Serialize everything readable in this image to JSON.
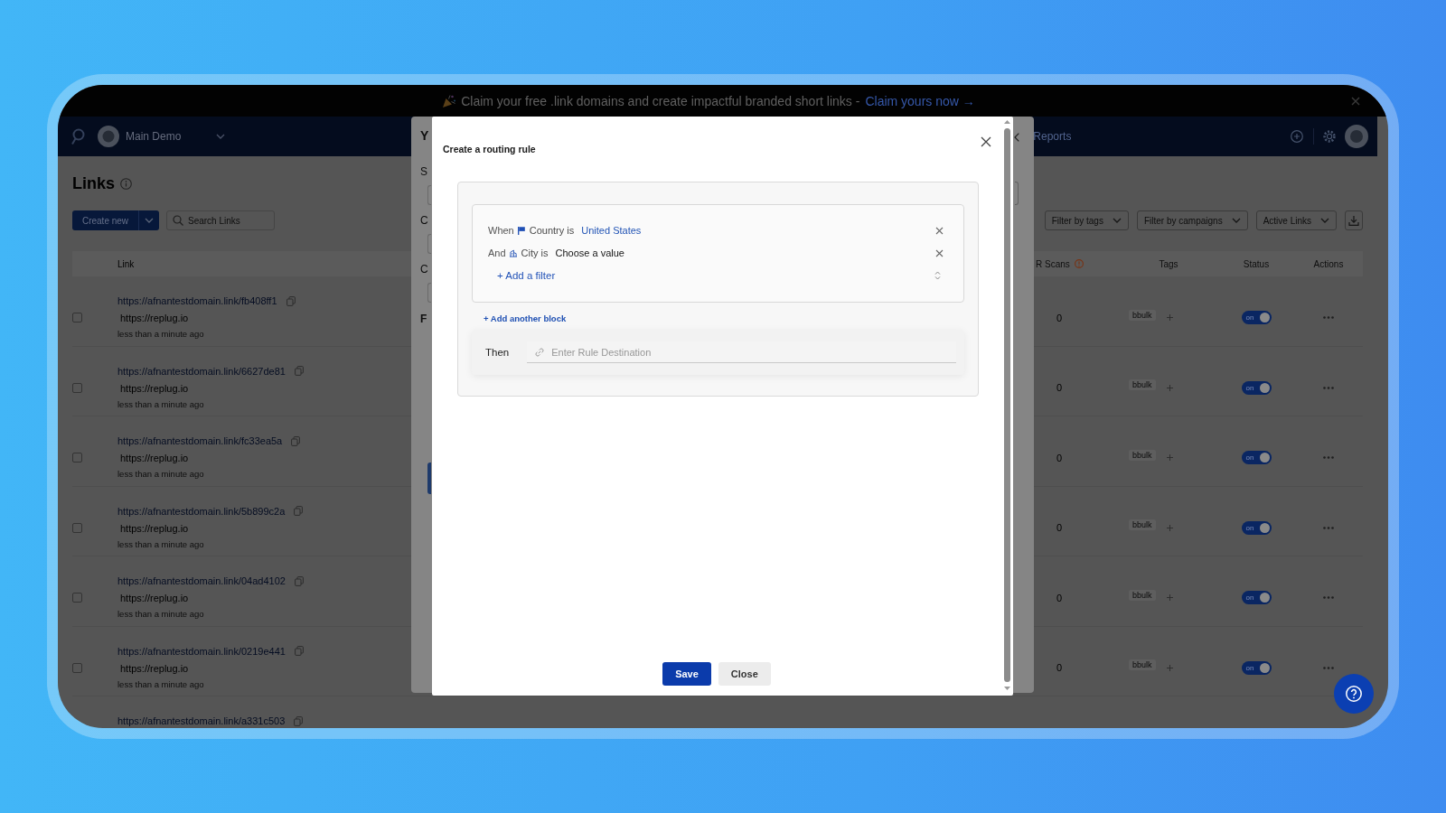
{
  "banner": {
    "text": "Claim your free .link domains and create impactful branded short links -",
    "link": "Claim yours now →"
  },
  "header": {
    "workspace": "Main Demo",
    "nav_item": "Reports"
  },
  "page": {
    "title": "Links",
    "create_button": "Create new",
    "search": {
      "placeholder": "Search Links"
    },
    "filters": [
      "Filter by tags",
      "Filter by campaigns",
      "Active Links"
    ]
  },
  "table": {
    "columns": [
      "Link",
      "R Scans",
      "Tags",
      "Status",
      "Actions"
    ],
    "rows": [
      {
        "checked": false,
        "url": "https://afnantestdomain.link/fb408ff1",
        "destination": "https://replug.io",
        "time": "less than a minute ago",
        "qr_scans": "0",
        "tag": "bbulk",
        "status": {
          "on": true,
          "label": "on"
        }
      },
      {
        "checked": false,
        "url": "https://afnantestdomain.link/6627de81",
        "destination": "https://replug.io",
        "time": "less than a minute ago",
        "qr_scans": "0",
        "tag": "bbulk",
        "status": {
          "on": true,
          "label": "on"
        }
      },
      {
        "checked": false,
        "url": "https://afnantestdomain.link/fc33ea5a",
        "destination": "https://replug.io",
        "time": "less than a minute ago",
        "qr_scans": "0",
        "tag": "bbulk",
        "status": {
          "on": true,
          "label": "on"
        }
      },
      {
        "checked": false,
        "url": "https://afnantestdomain.link/5b899c2a",
        "destination": "https://replug.io",
        "time": "less than a minute ago",
        "qr_scans": "0",
        "tag": "bbulk",
        "status": {
          "on": true,
          "label": "on"
        }
      },
      {
        "checked": false,
        "url": "https://afnantestdomain.link/04ad4102",
        "destination": "https://replug.io",
        "time": "less than a minute ago",
        "qr_scans": "0",
        "tag": "bbulk",
        "status": {
          "on": true,
          "label": "on"
        }
      },
      {
        "checked": false,
        "url": "https://afnantestdomain.link/0219e441",
        "destination": "https://replug.io",
        "time": "less than a minute ago",
        "qr_scans": "0",
        "tag": "bbulk",
        "status": {
          "on": true,
          "label": "on"
        }
      }
    ],
    "cut_row": {
      "url": "https://afnantestdomain.link/a331c503"
    }
  },
  "back_dialog": {
    "title_fragment": "Y",
    "label_fragments": [
      "S",
      "C",
      "C"
    ],
    "heading_fragment": "F"
  },
  "routing_dialog": {
    "title": "Create a routing rule",
    "blocks": [
      {
        "filters": [
          {
            "connector": "When",
            "kind": "country",
            "field": "Country is",
            "value": "United States",
            "value_set": true
          },
          {
            "connector": "And",
            "kind": "city",
            "field": "City is",
            "value": "Choose a value",
            "value_set": false
          }
        ],
        "add_filter": "+ Add a filter"
      }
    ],
    "add_block": "+ Add another block",
    "then": {
      "label": "Then",
      "placeholder": "Enter Rule Destination"
    },
    "buttons": [
      {
        "label": "Save",
        "kind": "primary"
      },
      {
        "label": "Close",
        "kind": "secondary"
      }
    ]
  }
}
